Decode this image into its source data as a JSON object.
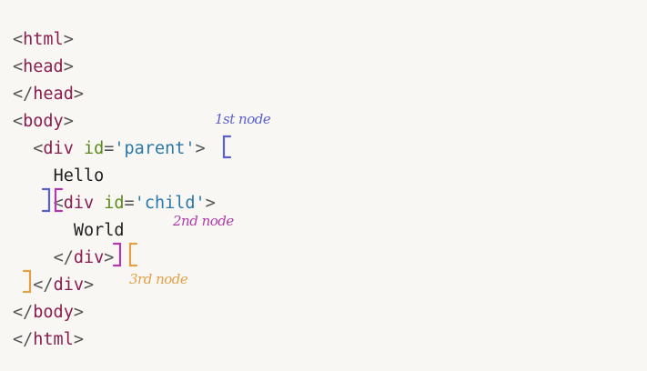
{
  "code": {
    "lines": [
      {
        "indent": "",
        "parts": [
          [
            "punct",
            "<"
          ],
          [
            "tag",
            "html"
          ],
          [
            "punct",
            ">"
          ]
        ]
      },
      {
        "indent": "",
        "parts": [
          [
            "punct",
            "<"
          ],
          [
            "tag",
            "head"
          ],
          [
            "punct",
            ">"
          ]
        ]
      },
      {
        "indent": "",
        "parts": [
          [
            "punct",
            "</"
          ],
          [
            "tag",
            "head"
          ],
          [
            "punct",
            ">"
          ]
        ]
      },
      {
        "indent": "",
        "parts": [
          [
            "punct",
            "<"
          ],
          [
            "tag",
            "body"
          ],
          [
            "punct",
            ">"
          ]
        ]
      },
      {
        "indent": "  ",
        "parts": [
          [
            "punct",
            "<"
          ],
          [
            "tag",
            "div"
          ],
          [
            "txt",
            " "
          ],
          [
            "attr",
            "id"
          ],
          [
            "punct",
            "="
          ],
          [
            "str",
            "'parent'"
          ],
          [
            "punct",
            ">"
          ]
        ]
      },
      {
        "indent": "    ",
        "parts": [
          [
            "txt",
            "Hello"
          ]
        ]
      },
      {
        "indent": "    ",
        "parts": [
          [
            "punct",
            "<"
          ],
          [
            "tag",
            "div"
          ],
          [
            "txt",
            " "
          ],
          [
            "attr",
            "id"
          ],
          [
            "punct",
            "="
          ],
          [
            "str",
            "'child'"
          ],
          [
            "punct",
            ">"
          ]
        ]
      },
      {
        "indent": "      ",
        "parts": [
          [
            "txt",
            "World"
          ]
        ]
      },
      {
        "indent": "    ",
        "parts": [
          [
            "punct",
            "</"
          ],
          [
            "tag",
            "div"
          ],
          [
            "punct",
            ">"
          ]
        ]
      },
      {
        "indent": "  ",
        "parts": [
          [
            "punct",
            "</"
          ],
          [
            "tag",
            "div"
          ],
          [
            "punct",
            ">"
          ]
        ]
      },
      {
        "indent": "",
        "parts": [
          [
            "punct",
            "</"
          ],
          [
            "tag",
            "body"
          ],
          [
            "punct",
            ">"
          ]
        ]
      },
      {
        "indent": "",
        "parts": [
          [
            "punct",
            "</"
          ],
          [
            "tag",
            "html"
          ],
          [
            "punct",
            ">"
          ]
        ]
      }
    ]
  },
  "annotations": {
    "first_node": {
      "label": "1st node",
      "color": "#5b5fc7"
    },
    "second_node": {
      "label": "2nd node",
      "color": "#b03aa8"
    },
    "third_node": {
      "label": "3rd node",
      "color": "#e0a247"
    }
  }
}
